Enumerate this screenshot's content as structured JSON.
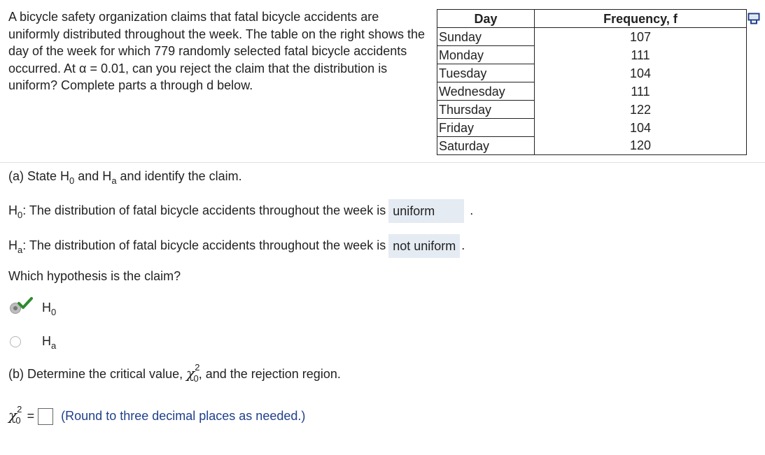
{
  "problem": {
    "text": "A bicycle safety organization claims that fatal bicycle accidents are uniformly distributed throughout the week. The table on the right shows the day of the week for which 779 randomly selected fatal bicycle accidents occurred. At α = 0.01, can you reject the claim that the distribution is uniform? Complete parts a through d below."
  },
  "table": {
    "headers": [
      "Day",
      "Frequency, f"
    ],
    "rows": [
      {
        "day": "Sunday",
        "f": "107"
      },
      {
        "day": "Monday",
        "f": "111"
      },
      {
        "day": "Tuesday",
        "f": "104"
      },
      {
        "day": "Wednesday",
        "f": "111"
      },
      {
        "day": "Thursday",
        "f": "122"
      },
      {
        "day": "Friday",
        "f": "104"
      },
      {
        "day": "Saturday",
        "f": "120"
      }
    ]
  },
  "part_a": {
    "heading_pre": "(a) State H",
    "heading_sub0": "0",
    "heading_mid": " and H",
    "heading_suba": "a",
    "heading_post": " and identify the claim.",
    "h0_label": "H",
    "h0_sub": "0",
    "h0_text": ": The distribution of fatal bicycle accidents throughout the week is",
    "h0_answer": "uniform",
    "h0_end": ".",
    "ha_label": "H",
    "ha_sub": "a",
    "ha_text": ": The distribution of fatal bicycle accidents throughout the week is",
    "ha_answer": "not uniform",
    "ha_end": ".",
    "question": "Which hypothesis is the claim?",
    "options": [
      {
        "label": "H",
        "sub": "0",
        "selected": true
      },
      {
        "label": "H",
        "sub": "a",
        "selected": false
      }
    ]
  },
  "part_b": {
    "heading_pre": "(b) Determine the critical value,",
    "chi": "χ",
    "sup": "2",
    "sub": "0",
    "heading_post": ", and the rejection region.",
    "eq_chi": "χ",
    "eq_sup": "2",
    "eq_sub": "0",
    "eq_sign": "=",
    "hint": "(Round to three decimal places as needed.)"
  },
  "colors": {
    "answer_bg": "#e5ebf3",
    "check": "#2e8b2e",
    "hint": "#1f3f8a"
  },
  "icons": {
    "copy": "copy-to-clipboard-icon",
    "check": "checkmark-icon"
  }
}
